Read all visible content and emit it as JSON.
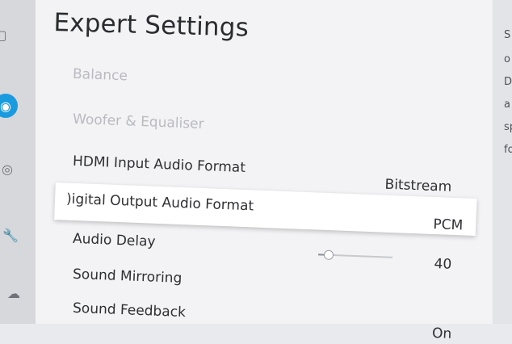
{
  "rail": {
    "icons": [
      "monitor-icon",
      "sound-icon",
      "broadcast-icon",
      "wrench-icon",
      "support-icon"
    ],
    "active_index": 1
  },
  "page": {
    "title": "Expert Settings"
  },
  "menu": [
    {
      "label": "Balance",
      "value": "",
      "disabled": true
    },
    {
      "label": "Woofer & Equaliser",
      "value": "",
      "disabled": true
    },
    {
      "label": "HDMI Input Audio Format",
      "value": "Bitstream",
      "disabled": false
    },
    {
      "label": ")igital Output Audio Format",
      "value": "PCM",
      "disabled": false,
      "focused": true
    },
    {
      "label": "Audio Delay",
      "value": "40",
      "disabled": false
    },
    {
      "label": "Sound Mirroring",
      "value": "",
      "disabled": false
    },
    {
      "label": "Sound Feedback",
      "value": "On",
      "disabled": false
    }
  ],
  "audio_delay_slider": {
    "level": 0.13
  },
  "description": {
    "lines": [
      "S",
      "o",
      "D",
      "a",
      "sp",
      "fo"
    ]
  },
  "colors": {
    "accent": "#1a9be0",
    "focus_bg": "#ffffff",
    "panel_bg": "#f3f3f5",
    "disabled_text": "#b9bbc0"
  }
}
